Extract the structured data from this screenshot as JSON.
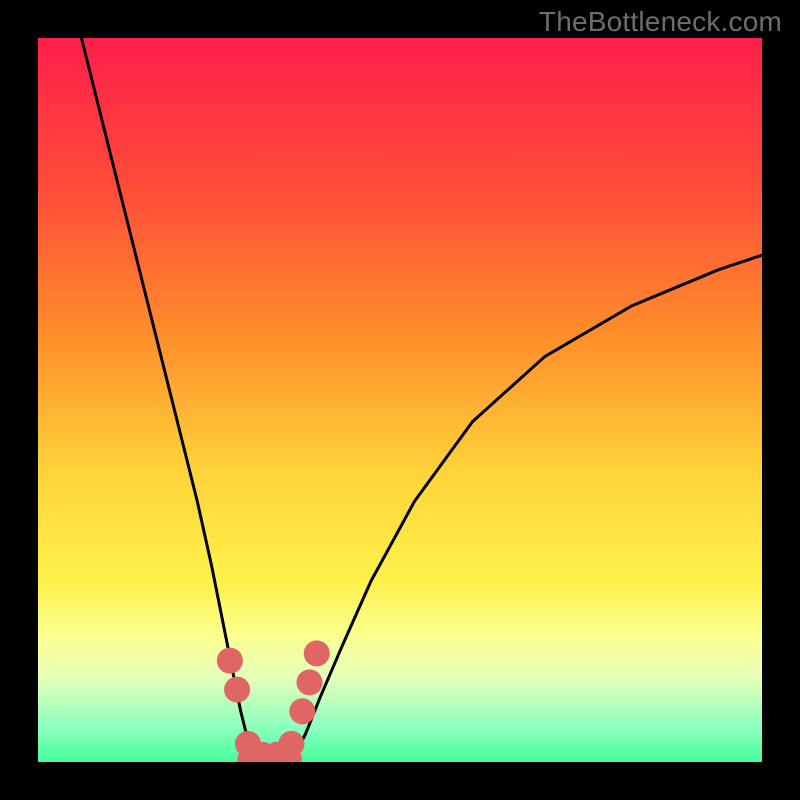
{
  "watermark": "TheBottleneck.com",
  "chart_data": {
    "type": "line",
    "title": "",
    "xlabel": "",
    "ylabel": "",
    "xlim": [
      0,
      100
    ],
    "ylim": [
      0,
      100
    ],
    "grid": false,
    "legend": false,
    "background": {
      "type": "vertical-gradient",
      "stops": [
        {
          "pos": 0.0,
          "color": "#ff1f4a"
        },
        {
          "pos": 0.2,
          "color": "#ff4a3a"
        },
        {
          "pos": 0.4,
          "color": "#ff8a2a"
        },
        {
          "pos": 0.6,
          "color": "#ffd43a"
        },
        {
          "pos": 0.75,
          "color": "#fff14a"
        },
        {
          "pos": 0.82,
          "color": "#fbff8a"
        },
        {
          "pos": 0.88,
          "color": "#e8ffb8"
        },
        {
          "pos": 0.95,
          "color": "#8fffbf"
        },
        {
          "pos": 1.0,
          "color": "#44ff9d"
        }
      ]
    },
    "series": [
      {
        "name": "left-branch",
        "x": [
          6,
          8,
          10,
          12,
          14,
          16,
          18,
          20,
          22,
          24,
          26,
          27,
          28,
          29,
          30
        ],
        "y": [
          100,
          92,
          84,
          76,
          68,
          60,
          52,
          44,
          36,
          27,
          17,
          12,
          7,
          3,
          0
        ]
      },
      {
        "name": "right-branch",
        "x": [
          35,
          37,
          39,
          42,
          46,
          52,
          60,
          70,
          82,
          94,
          100
        ],
        "y": [
          0,
          4,
          9,
          16,
          25,
          36,
          47,
          56,
          63,
          68,
          70
        ]
      },
      {
        "name": "valley-floor",
        "x": [
          28.5,
          35.5
        ],
        "y": [
          0.5,
          0.5
        ]
      }
    ],
    "markers": {
      "name": "valley-markers",
      "color": "#e06666",
      "radius_pct": 1.8,
      "points": [
        {
          "x": 26.5,
          "y": 14
        },
        {
          "x": 27.5,
          "y": 10
        },
        {
          "x": 29.0,
          "y": 2.5
        },
        {
          "x": 31.0,
          "y": 1.0
        },
        {
          "x": 33.0,
          "y": 1.0
        },
        {
          "x": 35.0,
          "y": 2.5
        },
        {
          "x": 36.5,
          "y": 7
        },
        {
          "x": 37.5,
          "y": 11
        },
        {
          "x": 38.5,
          "y": 15
        }
      ]
    }
  }
}
